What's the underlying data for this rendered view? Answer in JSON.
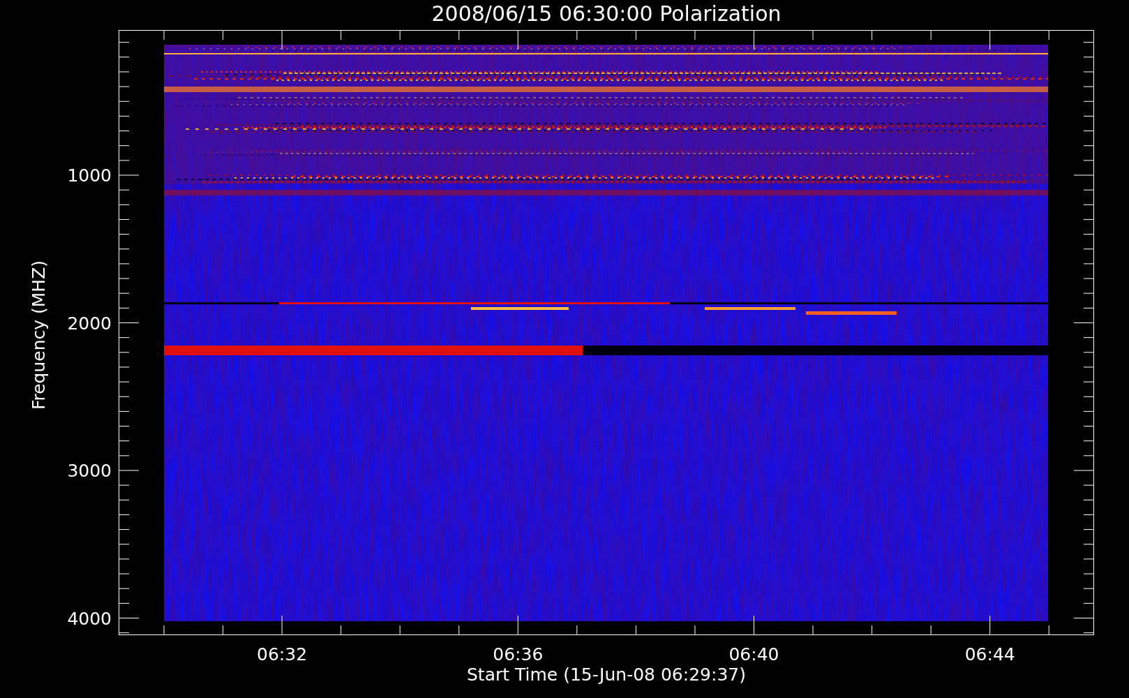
{
  "title": "2008/06/15 06:30:00 Polarization",
  "y_axis": {
    "label": "Frequency (MHZ)",
    "ticks": [
      "1000",
      "2000",
      "3000",
      "4000"
    ]
  },
  "x_axis": {
    "label": "Start Time (15-Jun-08 06:29:37)",
    "ticks": [
      "06:32",
      "06:36",
      "06:40",
      "06:44"
    ]
  }
}
